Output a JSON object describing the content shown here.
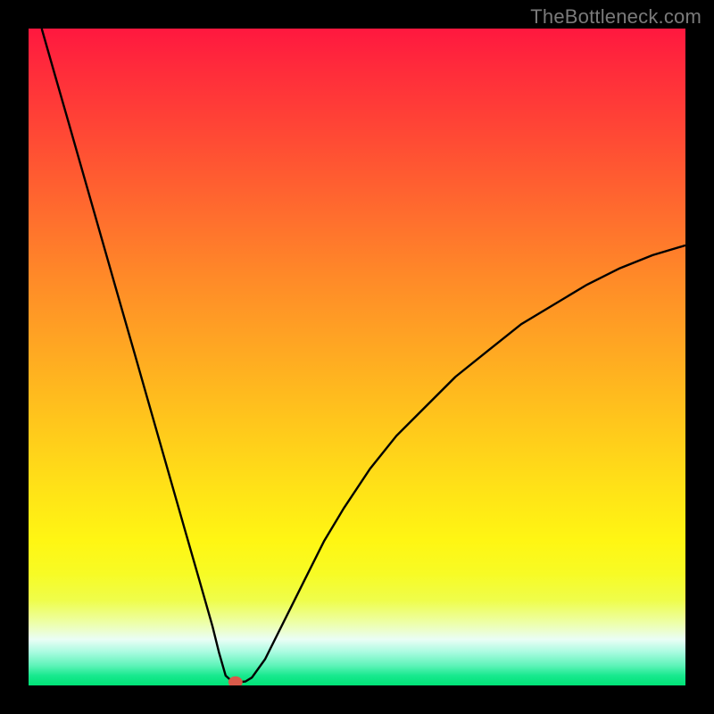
{
  "watermark": "TheBottleneck.com",
  "chart_data": {
    "type": "line",
    "title": "",
    "xlabel": "",
    "ylabel": "",
    "xlim": [
      0,
      100
    ],
    "ylim": [
      0,
      100
    ],
    "series": [
      {
        "name": "bottleneck-curve",
        "x": [
          2,
          4,
          6,
          8,
          10,
          12,
          14,
          16,
          18,
          20,
          22,
          24,
          26,
          28,
          29,
          30,
          31,
          32,
          33,
          34,
          36,
          38,
          40,
          42,
          45,
          48,
          52,
          56,
          60,
          65,
          70,
          75,
          80,
          85,
          90,
          95,
          100
        ],
        "values": [
          100,
          93,
          86,
          79,
          72,
          65,
          58,
          51,
          44,
          37,
          30,
          23,
          16,
          9,
          5,
          1.5,
          0.6,
          0.5,
          0.6,
          1.2,
          4,
          8,
          12,
          16,
          22,
          27,
          33,
          38,
          42,
          47,
          51,
          55,
          58,
          61,
          63.5,
          65.5,
          67
        ]
      }
    ],
    "marker": {
      "x": 31.5,
      "y": 0.5
    },
    "gradient_stops": [
      {
        "pos": 0,
        "color": "#ff183f"
      },
      {
        "pos": 0.5,
        "color": "#ffb61f"
      },
      {
        "pos": 0.78,
        "color": "#fff613"
      },
      {
        "pos": 1.0,
        "color": "#00e277"
      }
    ]
  }
}
